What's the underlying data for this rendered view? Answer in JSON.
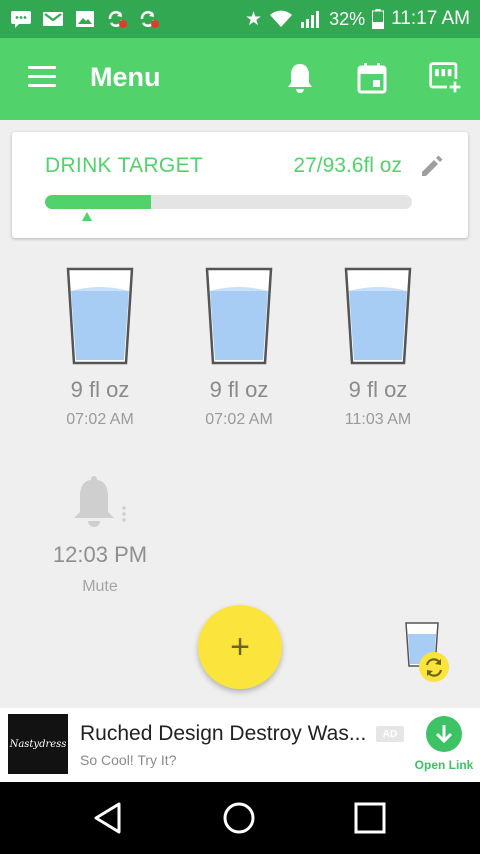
{
  "status_bar": {
    "icons": [
      "chat-icon",
      "gmail-icon",
      "gallery-icon",
      "sync-alert-icon",
      "sync-alert-icon",
      "star-icon",
      "wifi-icon",
      "signal-icon",
      "battery-icon"
    ],
    "battery_percent": "32%",
    "time": "11:17 AM"
  },
  "app_bar": {
    "title": "Menu",
    "actions": [
      "bell-icon",
      "calendar-icon",
      "add-cup-icon"
    ]
  },
  "drink_target": {
    "label": "DRINK TARGET",
    "amount": "27/93.6fl oz",
    "progress_fraction": 0.288
  },
  "entries": [
    {
      "amount": "9 fl oz",
      "time": "07:02 AM"
    },
    {
      "amount": "9 fl oz",
      "time": "07:02 AM"
    },
    {
      "amount": "9 fl oz",
      "time": "11:03 AM"
    }
  ],
  "reminder": {
    "time": "12:03 PM",
    "label": "Mute"
  },
  "fab": {
    "label": "+"
  },
  "ad": {
    "thumb_text": "Nastydress",
    "title": "Ruched Design Destroy Was...",
    "subtitle": "So Cool! Try It?",
    "badge": "AD",
    "action_label": "Open Link"
  },
  "colors": {
    "status_bar": "#33a852",
    "primary": "#52d26b",
    "fab": "#fbe43b",
    "water": "#a8cdf5"
  }
}
